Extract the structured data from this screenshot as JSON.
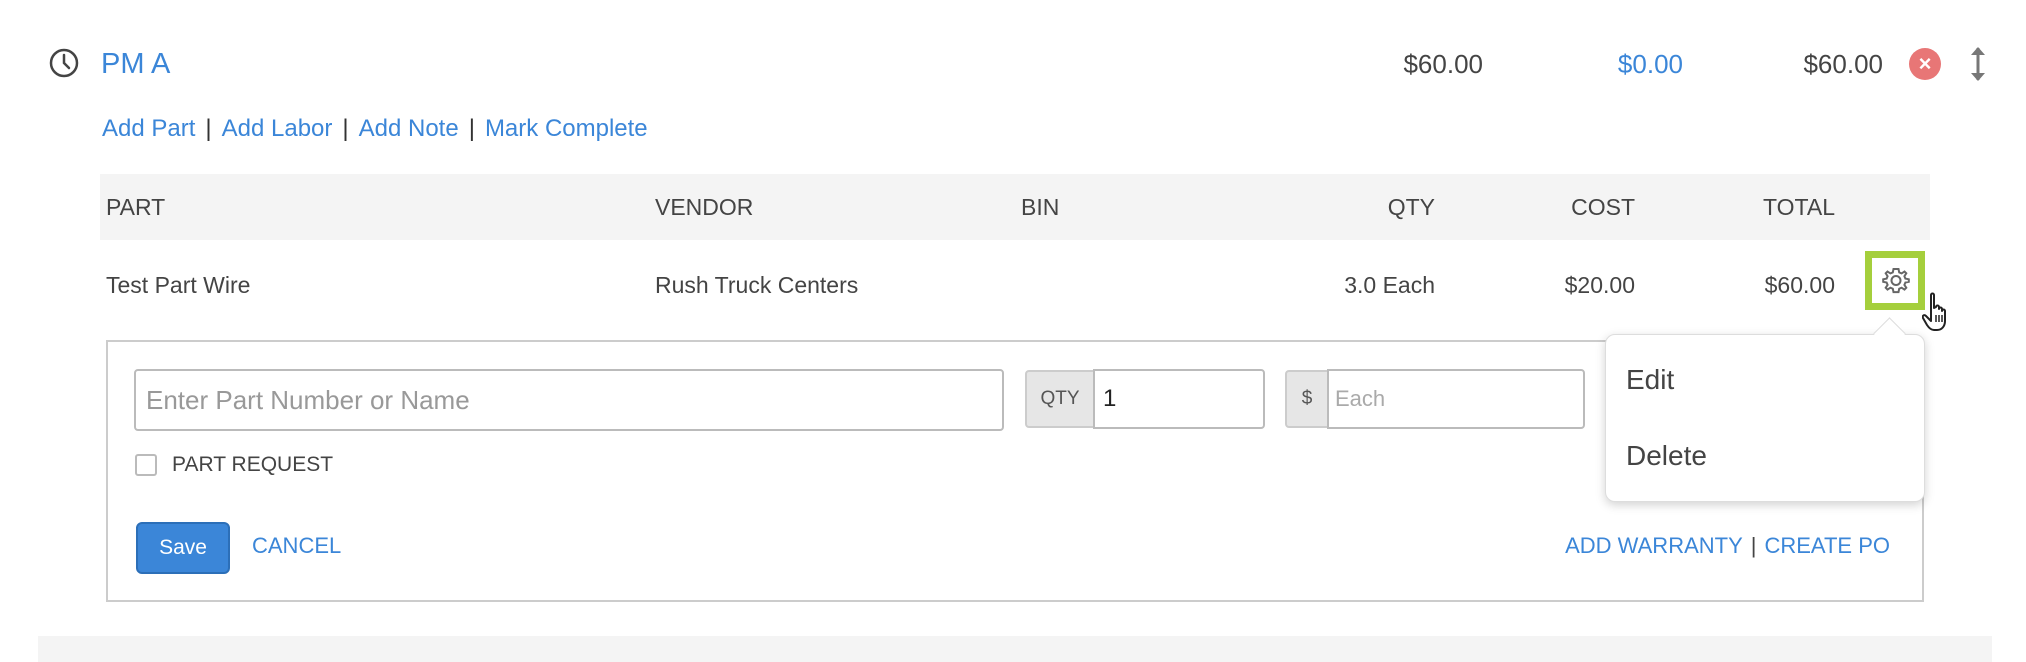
{
  "header": {
    "title": "PM A",
    "amount_parts": "$60.00",
    "amount_labor": "$0.00",
    "amount_total": "$60.00",
    "clock_icon": "clock-icon",
    "remove_icon": "close-icon",
    "sort_icon": "sort-vertical-icon"
  },
  "actions": {
    "add_part": "Add Part",
    "add_labor": "Add Labor",
    "add_note": "Add Note",
    "mark_complete": "Mark Complete",
    "separator": "|"
  },
  "table": {
    "columns": [
      "PART",
      "VENDOR",
      "BIN",
      "QTY",
      "COST",
      "TOTAL"
    ],
    "rows": [
      {
        "part": "Test Part Wire",
        "vendor": "Rush Truck Centers",
        "bin": "",
        "qty": "3.0 Each",
        "cost": "$20.00",
        "total": "$60.00"
      }
    ],
    "row_menu_icon": "gear-icon"
  },
  "form": {
    "part_placeholder": "Enter Part Number or Name",
    "qty_label": "QTY",
    "qty_value": "1",
    "currency_label": "$",
    "each_placeholder": "Each",
    "part_request_label": "PART REQUEST",
    "part_request_checked": false,
    "save_label": "Save",
    "cancel_label": "CANCEL",
    "add_warranty_label": "ADD WARRANTY",
    "create_po_label": "CREATE PO",
    "separator": "|"
  },
  "row_menu": {
    "items": [
      {
        "label": "Edit"
      },
      {
        "label": "Delete"
      }
    ]
  },
  "colors": {
    "link": "#3b86d8",
    "highlight": "#a5cf3c",
    "danger": "#e87676"
  }
}
